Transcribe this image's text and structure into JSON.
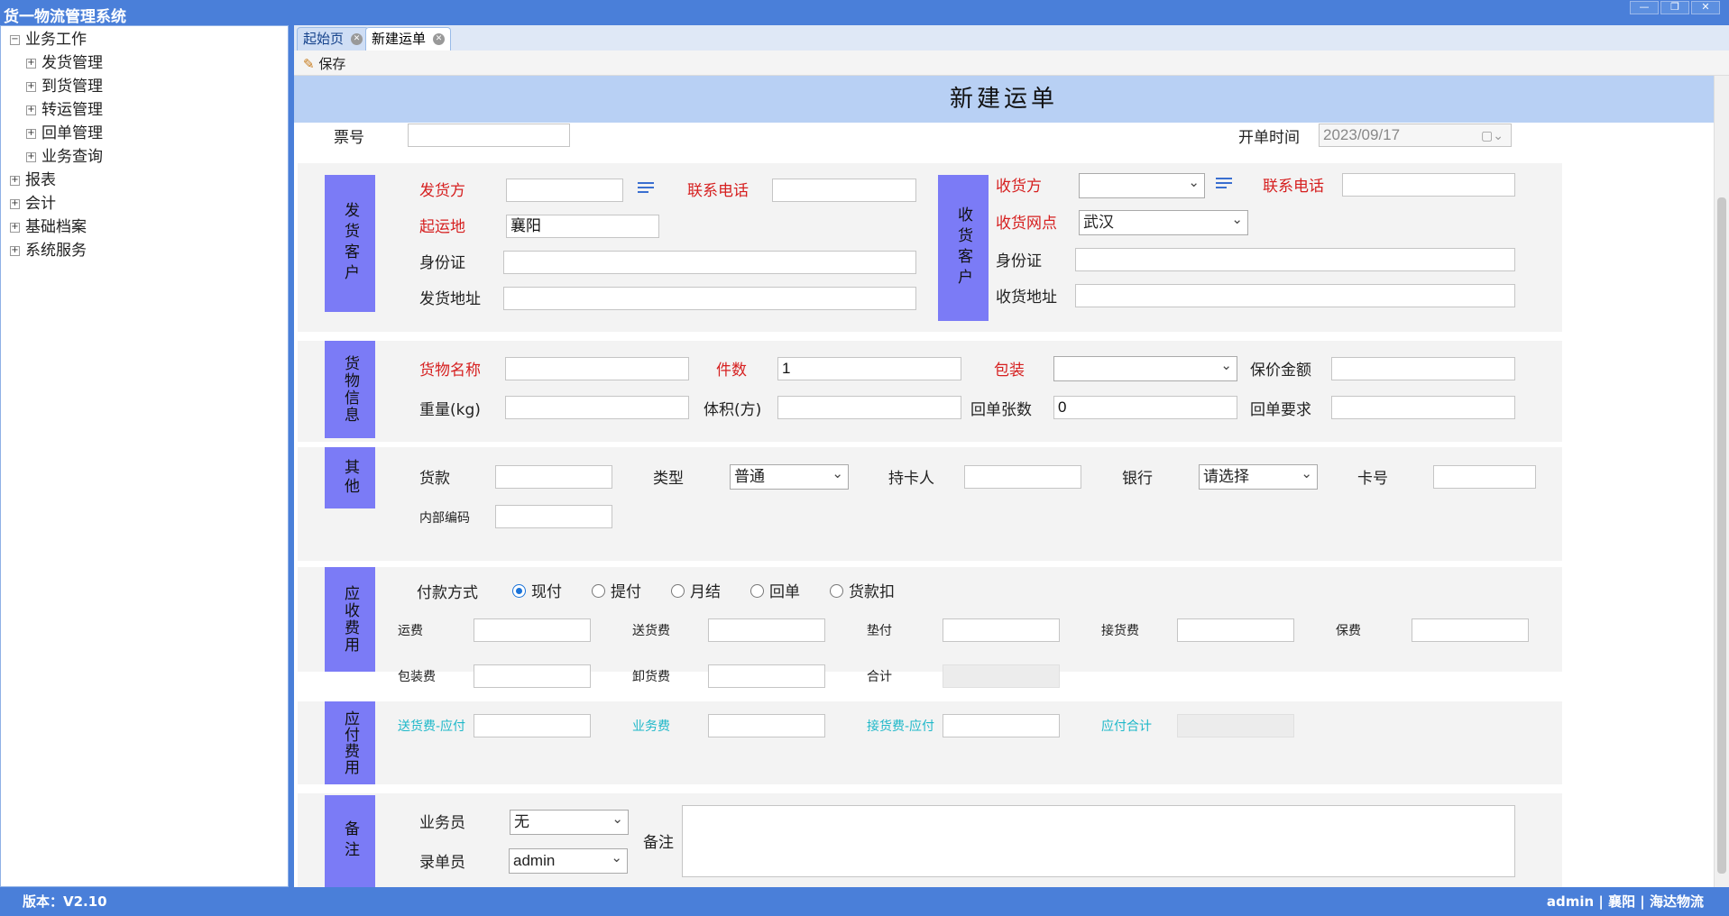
{
  "app": {
    "title": "货一物流管理系统"
  },
  "window_buttons": {
    "min": "—",
    "restore": "❐",
    "close": "✕"
  },
  "tree": {
    "root": "业务工作",
    "children": [
      "发货管理",
      "到货管理",
      "转运管理",
      "回单管理",
      "业务查询"
    ],
    "others": [
      "报表",
      "会计",
      "基础档案",
      "系统服务"
    ]
  },
  "tabs": [
    {
      "label": "起始页"
    },
    {
      "label": "新建运单"
    }
  ],
  "toolbar": {
    "save_label": "保存"
  },
  "form": {
    "title": "新建运单",
    "ticket_label": "票号",
    "ticket_value": "",
    "open_time_label": "开单时间",
    "open_time_value": "2023/09/17",
    "sender": {
      "section": "发货客户",
      "shipper_label": "发货方",
      "phone_label": "联系电话",
      "origin_label": "起运地",
      "origin_value": "襄阳",
      "id_label": "身份证",
      "address_label": "发货地址"
    },
    "receiver": {
      "section": "收货客户",
      "consignee_label": "收货方",
      "phone_label": "联系电话",
      "outlet_label": "收货网点",
      "outlet_value": "武汉",
      "id_label": "身份证",
      "address_label": "收货地址"
    },
    "goods": {
      "section": "货物信息",
      "name_label": "货物名称",
      "count_label": "件数",
      "count_value": "1",
      "pack_label": "包装",
      "insured_label": "保价金额",
      "weight_label": "重量(kg)",
      "volume_label": "体积(方)",
      "receipts_label": "回单张数",
      "receipts_value": "0",
      "receipt_req_label": "回单要求"
    },
    "other": {
      "section": "其他",
      "payment_label": "货款",
      "type_label": "类型",
      "type_value": "普通",
      "holder_label": "持卡人",
      "bank_label": "银行",
      "bank_value": "请选择",
      "card_label": "卡号",
      "internal_code_label": "内部编码"
    },
    "receivable": {
      "section": "应收费用",
      "pay_method_label": "付款方式",
      "options": [
        "现付",
        "提付",
        "月结",
        "回单",
        "货款扣"
      ],
      "selected": "现付",
      "freight_label": "运费",
      "delivery_label": "送货费",
      "advance_label": "垫付",
      "pickup_label": "接货费",
      "insurance_label": "保费",
      "packing_label": "包装费",
      "unload_label": "卸货费",
      "total_label": "合计"
    },
    "payable": {
      "section": "应付费用",
      "delivery_pay_label": "送货费-应付",
      "business_fee_label": "业务费",
      "pickup_pay_label": "接货费-应付",
      "total_label": "应付合计"
    },
    "notes": {
      "section": "备注",
      "salesman_label": "业务员",
      "salesman_value": "无",
      "clerk_label": "录单员",
      "clerk_value": "admin",
      "remark_label": "备注"
    }
  },
  "status": {
    "version": "版本：V2.10",
    "user_info": "admin | 襄阳 | 海达物流"
  }
}
